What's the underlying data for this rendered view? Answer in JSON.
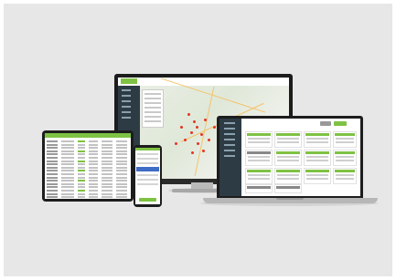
{
  "scene": {
    "background": "#e7e7e7",
    "accent": "#7ec243",
    "sidebar_color": "#2d3b44",
    "pin_color": "#e63323"
  },
  "devices": [
    "monitor",
    "laptop",
    "tablet",
    "phone"
  ],
  "monitor": {
    "view": "map",
    "icons": [
      "map-pin-icon"
    ]
  },
  "laptop": {
    "view": "job-cards"
  },
  "tablet": {
    "view": "data-table"
  },
  "phone": {
    "view": "mobile-list"
  }
}
